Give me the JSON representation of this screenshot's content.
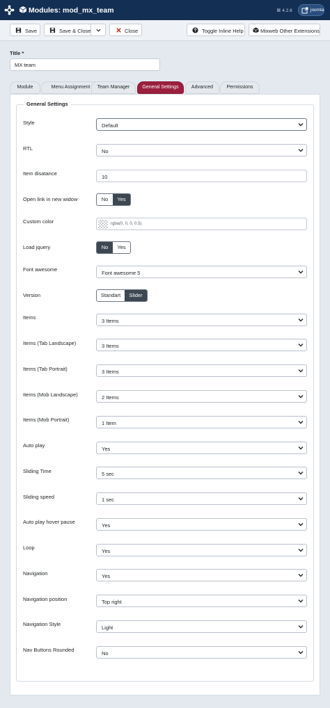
{
  "header": {
    "title": "Modules: mod_mx_team",
    "version": "⌘ 4.2.6",
    "user_label": "joomla"
  },
  "toolbar": {
    "save": "Save",
    "save_close": "Save & Close",
    "close": "Close",
    "toggle_help": "Toggle Inline Help",
    "mixweb": "Mixweb Other Extensions"
  },
  "form": {
    "title_label": "Title *",
    "title_value": "MX team"
  },
  "tabs": [
    "Module",
    "Menu Assignment",
    "Team Manager",
    "General Settings",
    "Advanced",
    "Permissions"
  ],
  "legend": "General Settings",
  "fields": {
    "style": {
      "label": "Style",
      "value": "Default"
    },
    "rtl": {
      "label": "RTL",
      "value": "No"
    },
    "item_distance": {
      "label": "Item disatance",
      "value": "10"
    },
    "open_link": {
      "label": "Open link in new widow",
      "opt_a": "No",
      "opt_b": "Yes"
    },
    "custom_color": {
      "label": "Custom color",
      "value": "rgba(0, 0, 0, 0.5)"
    },
    "load_jquery": {
      "label": "Load jquery",
      "opt_a": "No",
      "opt_b": "Yes"
    },
    "font_awesome": {
      "label": "Font awesome",
      "value": "Font awesome 5"
    },
    "version": {
      "label": "Version",
      "opt_a": "Standart",
      "opt_b": "Slider"
    },
    "items": {
      "label": "Items",
      "value": "3 Items"
    },
    "items_tab_landscape": {
      "label": "Items (Tab Landscape)",
      "value": "3 Items"
    },
    "items_tab_portrait": {
      "label": "Items (Tab Portrait)",
      "value": "3 Items"
    },
    "items_mob_landscape": {
      "label": "Items (Mob Landscape)",
      "value": "2 Items"
    },
    "items_mob_portrait": {
      "label": "Items (Mob Portrait)",
      "value": "1 Item"
    },
    "auto_play": {
      "label": "Auto play",
      "value": "Yes"
    },
    "sliding_time": {
      "label": "Sliding Time",
      "value": "5 sec"
    },
    "sliding_speed": {
      "label": "Sliding speed",
      "value": "1 sec"
    },
    "auto_play_hover_pause": {
      "label": "Auto play hover pause",
      "value": "Yes"
    },
    "loop": {
      "label": "Loop",
      "value": "Yes"
    },
    "navigation": {
      "label": "Navigation",
      "value": "Yes"
    },
    "navigation_position": {
      "label": "Navigation position",
      "value": "Top right"
    },
    "navigation_style": {
      "label": "Navigation Style",
      "value": "Light"
    },
    "nav_buttons_rounded": {
      "label": "Nav Buttons Rounded",
      "value": "No"
    }
  },
  "colors": {
    "header_bg": "#132f53",
    "active_tab": "#9b1f3e",
    "toggle_on": "#3d4752"
  }
}
